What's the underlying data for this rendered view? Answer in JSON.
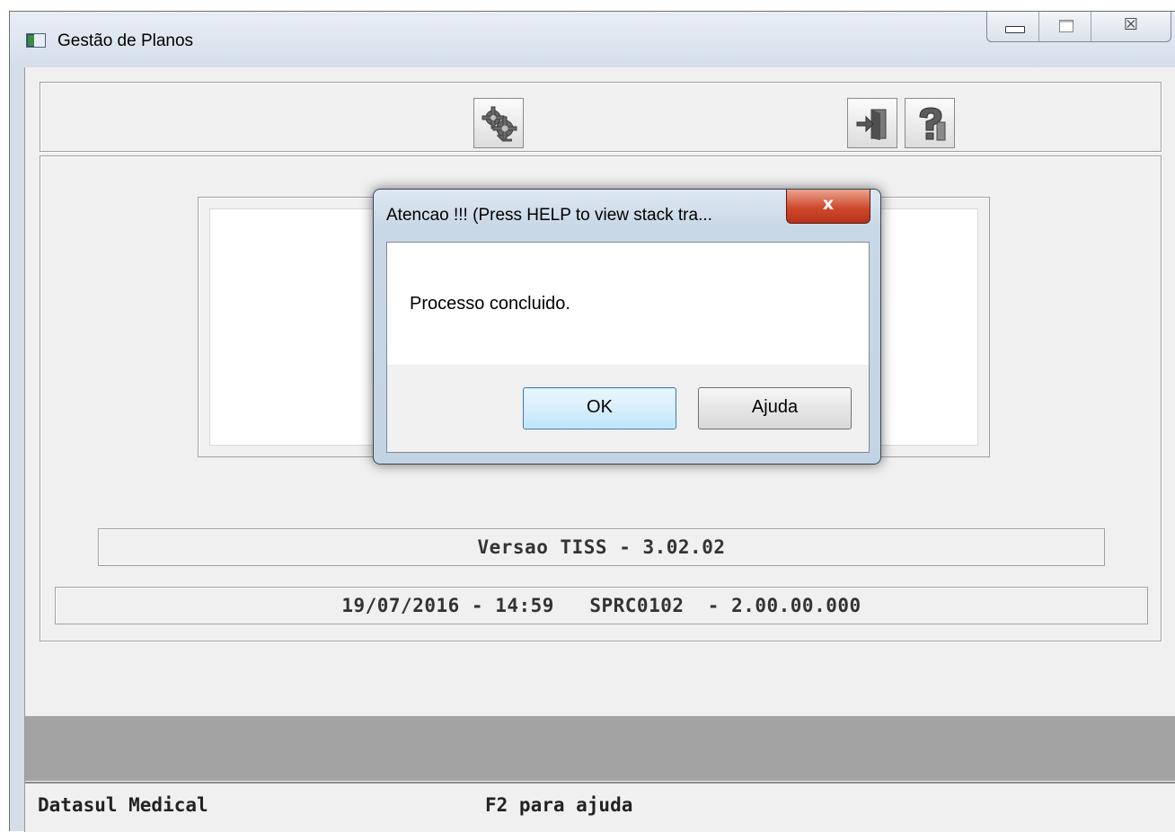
{
  "window": {
    "title": "Gestão de Planos",
    "controls": {
      "close_glyph": "☒"
    }
  },
  "toolbar": {
    "buttons": [
      {
        "icon": "gears-execute-icon"
      },
      {
        "icon": "exit-door-icon"
      },
      {
        "icon": "help-question-icon"
      }
    ]
  },
  "info": {
    "version": "Versao TISS - 3.02.02",
    "build": "19/07/2016 - 14:59   SPRC0102  - 2.00.00.000"
  },
  "statusbar": {
    "left": "Datasul Medical",
    "right": "F2 para ajuda"
  },
  "dialog": {
    "title": "Atencao !!! (Press HELP to view stack tra...",
    "close_label": "x",
    "message": "Processo concluido.",
    "ok_label": "OK",
    "help_label": "Ajuda"
  },
  "colors": {
    "dialog_close": "#cf4a2c",
    "ok_button_border": "#3c7fb1",
    "gray_band": "#a3a3a3"
  }
}
